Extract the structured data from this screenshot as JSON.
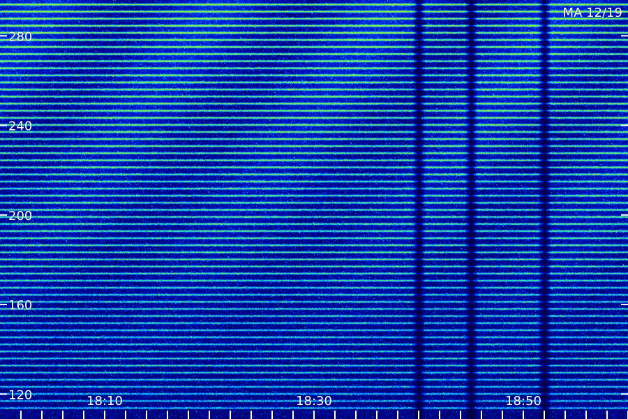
{
  "station_label": "MA 12/19",
  "colors": {
    "background": "#00002a",
    "low": "#001070",
    "mid": "#0a3cff",
    "high_cyan": "#17d6e6",
    "high_green": "#8ee640",
    "tick": "#ffffff"
  },
  "chart_data": {
    "type": "heatmap",
    "title": "",
    "xlabel": "",
    "ylabel": "",
    "x_tick_labels": [
      "18:10",
      "18:30",
      "18:50"
    ],
    "x_minor_ticks_minutes": [
      2,
      4,
      6,
      8,
      10,
      12,
      14,
      16,
      18,
      20,
      22,
      24,
      26,
      28,
      30,
      32,
      34,
      36,
      38,
      40,
      42,
      44,
      46,
      48,
      50,
      52,
      54,
      56,
      58,
      60
    ],
    "x_range": [
      "18:00",
      "19:00"
    ],
    "y_tick_values": [
      280,
      240,
      200,
      160,
      120
    ],
    "y_tick_labels": [
      "280",
      "240",
      "200",
      "160",
      "120"
    ],
    "y_range": [
      112,
      296
    ],
    "harmonic_lines_count": 58,
    "dark_vertical_bands": [
      "18:40",
      "18:45",
      "18:52"
    ],
    "grid": false,
    "colormap": [
      "navy",
      "blue",
      "cyan",
      "green"
    ]
  }
}
